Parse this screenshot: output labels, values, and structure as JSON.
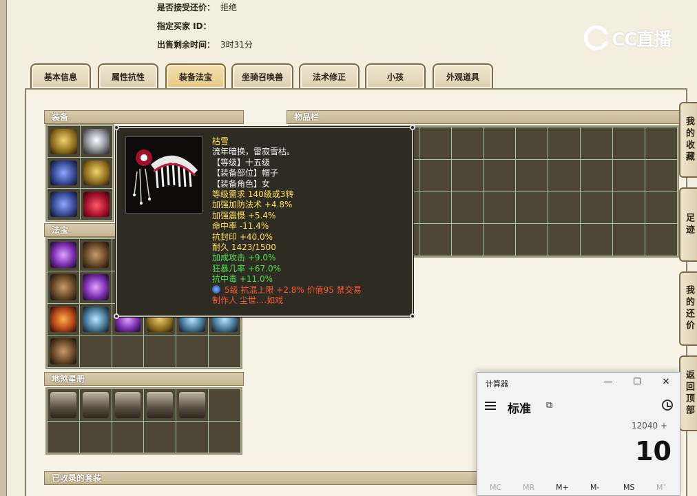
{
  "info": {
    "accept_counter_label": "是否接受还价：",
    "accept_counter_value": "拒绝",
    "buyer_id_label": "指定买家 ID：",
    "buyer_id_value": "",
    "remaining_label": "出售剩余时间：",
    "remaining_value": "3时31分"
  },
  "logo": {
    "text": "CC直播"
  },
  "tabs": [
    {
      "label": "基本信息"
    },
    {
      "label": "属性抗性"
    },
    {
      "label": "装备法宝"
    },
    {
      "label": "坐骑召唤兽"
    },
    {
      "label": "法术修正"
    },
    {
      "label": "小孩"
    },
    {
      "label": "外观道具"
    }
  ],
  "active_tab": 2,
  "sections": {
    "equipment": "装备",
    "treasure": "法宝",
    "star_book": "地煞星册",
    "inventory": "物品栏",
    "collected_sets": "已收录的套装"
  },
  "tooltip": {
    "name": "枯雪",
    "desc": "流年暗换，雷寂雪枯。",
    "level": "【等级】十五级",
    "slot": "【装备部位】帽子",
    "role": "【装备角色】女",
    "req": "等级需求 140级或3转",
    "stats_yellow": [
      "加强加防法术 +4.8%",
      "加强震慑 +5.4%",
      "命中率 -11.4%",
      "抗封印 +40.0%",
      "耐久 1423/1500"
    ],
    "stats_green": [
      "加成攻击 +9.0%",
      "狂暴几率 +67.0%",
      "抗中毒 +11.0%"
    ],
    "gem_line": "5级 抗混上限 +2.8% 价值95 禁交易",
    "maker": "制作人 尘世....如戏"
  },
  "side_tabs": [
    {
      "label": "我的收藏"
    },
    {
      "label": "足迹"
    },
    {
      "label": "我的还价"
    },
    {
      "label": "返回顶部"
    }
  ],
  "calculator": {
    "title": "计算器",
    "mode": "标准",
    "expression": "12040 +",
    "display": "10",
    "memory": [
      "MC",
      "MR",
      "M+",
      "M-",
      "MS",
      "M˅"
    ]
  }
}
